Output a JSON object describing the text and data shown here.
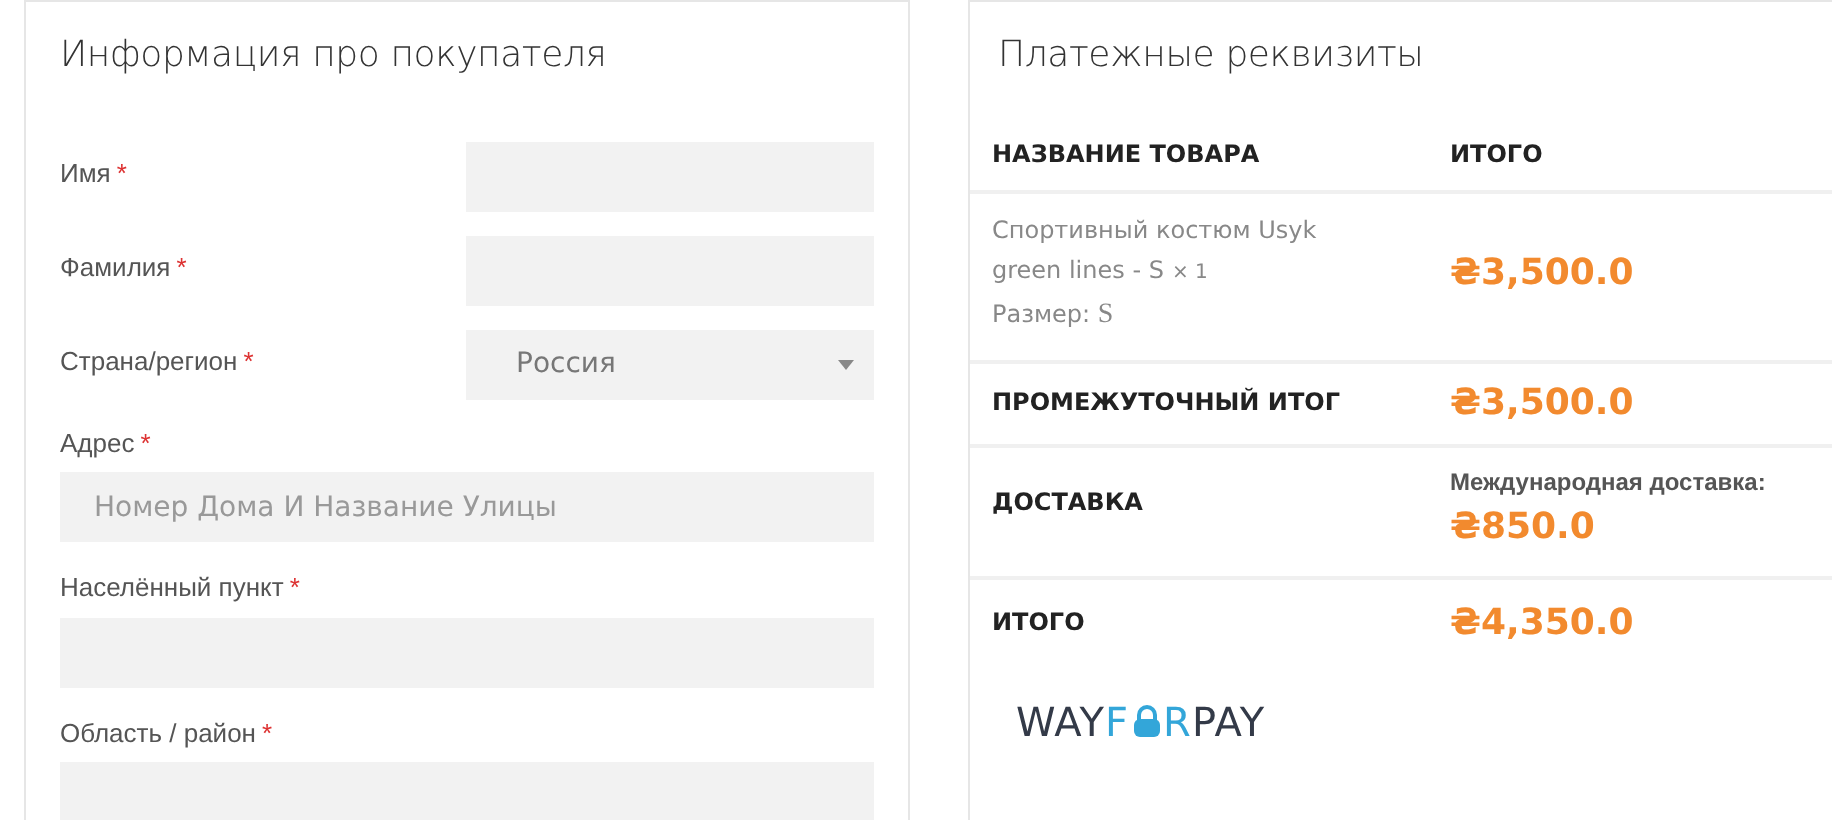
{
  "customer": {
    "title": "Информация про покупателя",
    "required_mark": "*",
    "fields": [
      {
        "kind": "inline_text",
        "label": "Имя",
        "required": true
      },
      {
        "kind": "inline_text",
        "label": "Фамилия",
        "required": true
      },
      {
        "kind": "inline_select",
        "label": "Страна/регион",
        "required": true,
        "value": "Россия"
      },
      {
        "kind": "stacked_text",
        "label": "Адрес",
        "required": true,
        "placeholder": "Номер Дома И Название Улицы"
      },
      {
        "kind": "stacked_text",
        "label": "Населённый пункт",
        "required": true
      },
      {
        "kind": "stacked_text",
        "label": "Область / район",
        "required": true
      }
    ]
  },
  "payment": {
    "title": "Платежные реквизиты",
    "columns": [
      "НАЗВАНИЕ ТОВАРА",
      "ИТОГО"
    ],
    "items": [
      {
        "name": "Спортивный костюм Usyk green lines - S",
        "quantity": "× 1",
        "variation_label": "Размер:",
        "variation_value": "S",
        "price": "₴3,500.0"
      }
    ],
    "subtotal": {
      "label": "ПРОМЕЖУТОЧНЫЙ ИТОГ",
      "value": "₴3,500.0"
    },
    "shipping": {
      "label": "ДОСТАВКА",
      "method": "Международная доставка:",
      "value": "₴850.0"
    },
    "total": {
      "label": "ИТОГО",
      "value": "₴4,350.0"
    },
    "payment_logo": {
      "left": "WAY",
      "left_accent": "F",
      "right_accent": "R",
      "right": "PAY"
    }
  }
}
